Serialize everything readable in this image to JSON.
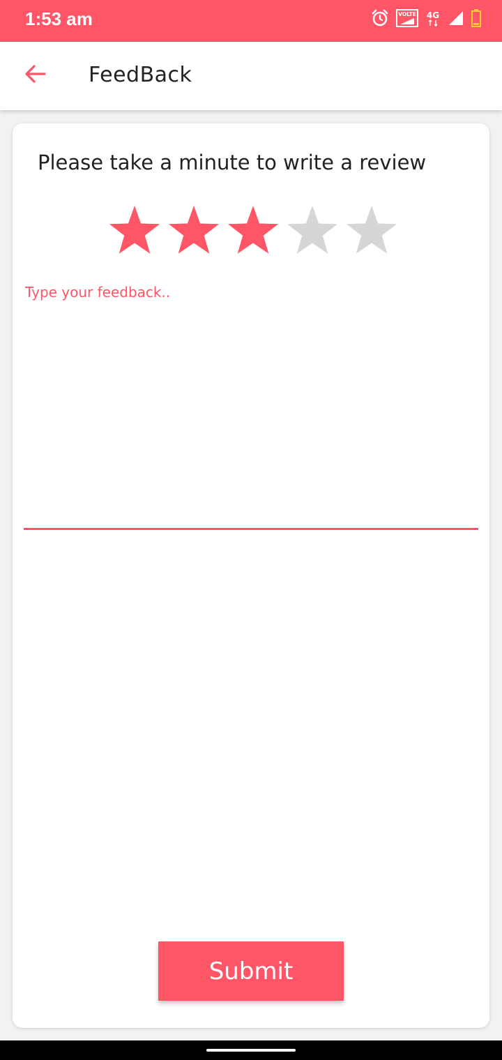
{
  "status_bar": {
    "time": "1:53 am",
    "icons": [
      "alarm-icon",
      "volte-icon",
      "4g-icon",
      "signal-icon",
      "battery-icon"
    ],
    "network_label": "4G",
    "volte_label": "VOLTE",
    "background_color": "#ff5667"
  },
  "app_bar": {
    "back_icon": "arrow-left-icon",
    "title": "FeedBack"
  },
  "feedback_form": {
    "prompt": "Please take a minute to write a review",
    "rating": {
      "value": 3,
      "max": 5,
      "filled_color": "#ff5667",
      "empty_color": "#d6d6d6"
    },
    "feedback_field": {
      "value": "",
      "placeholder": "Type your feedback.."
    },
    "submit_label": "Submit"
  },
  "theme": {
    "accent": "#ff5667",
    "text": "#222222"
  }
}
